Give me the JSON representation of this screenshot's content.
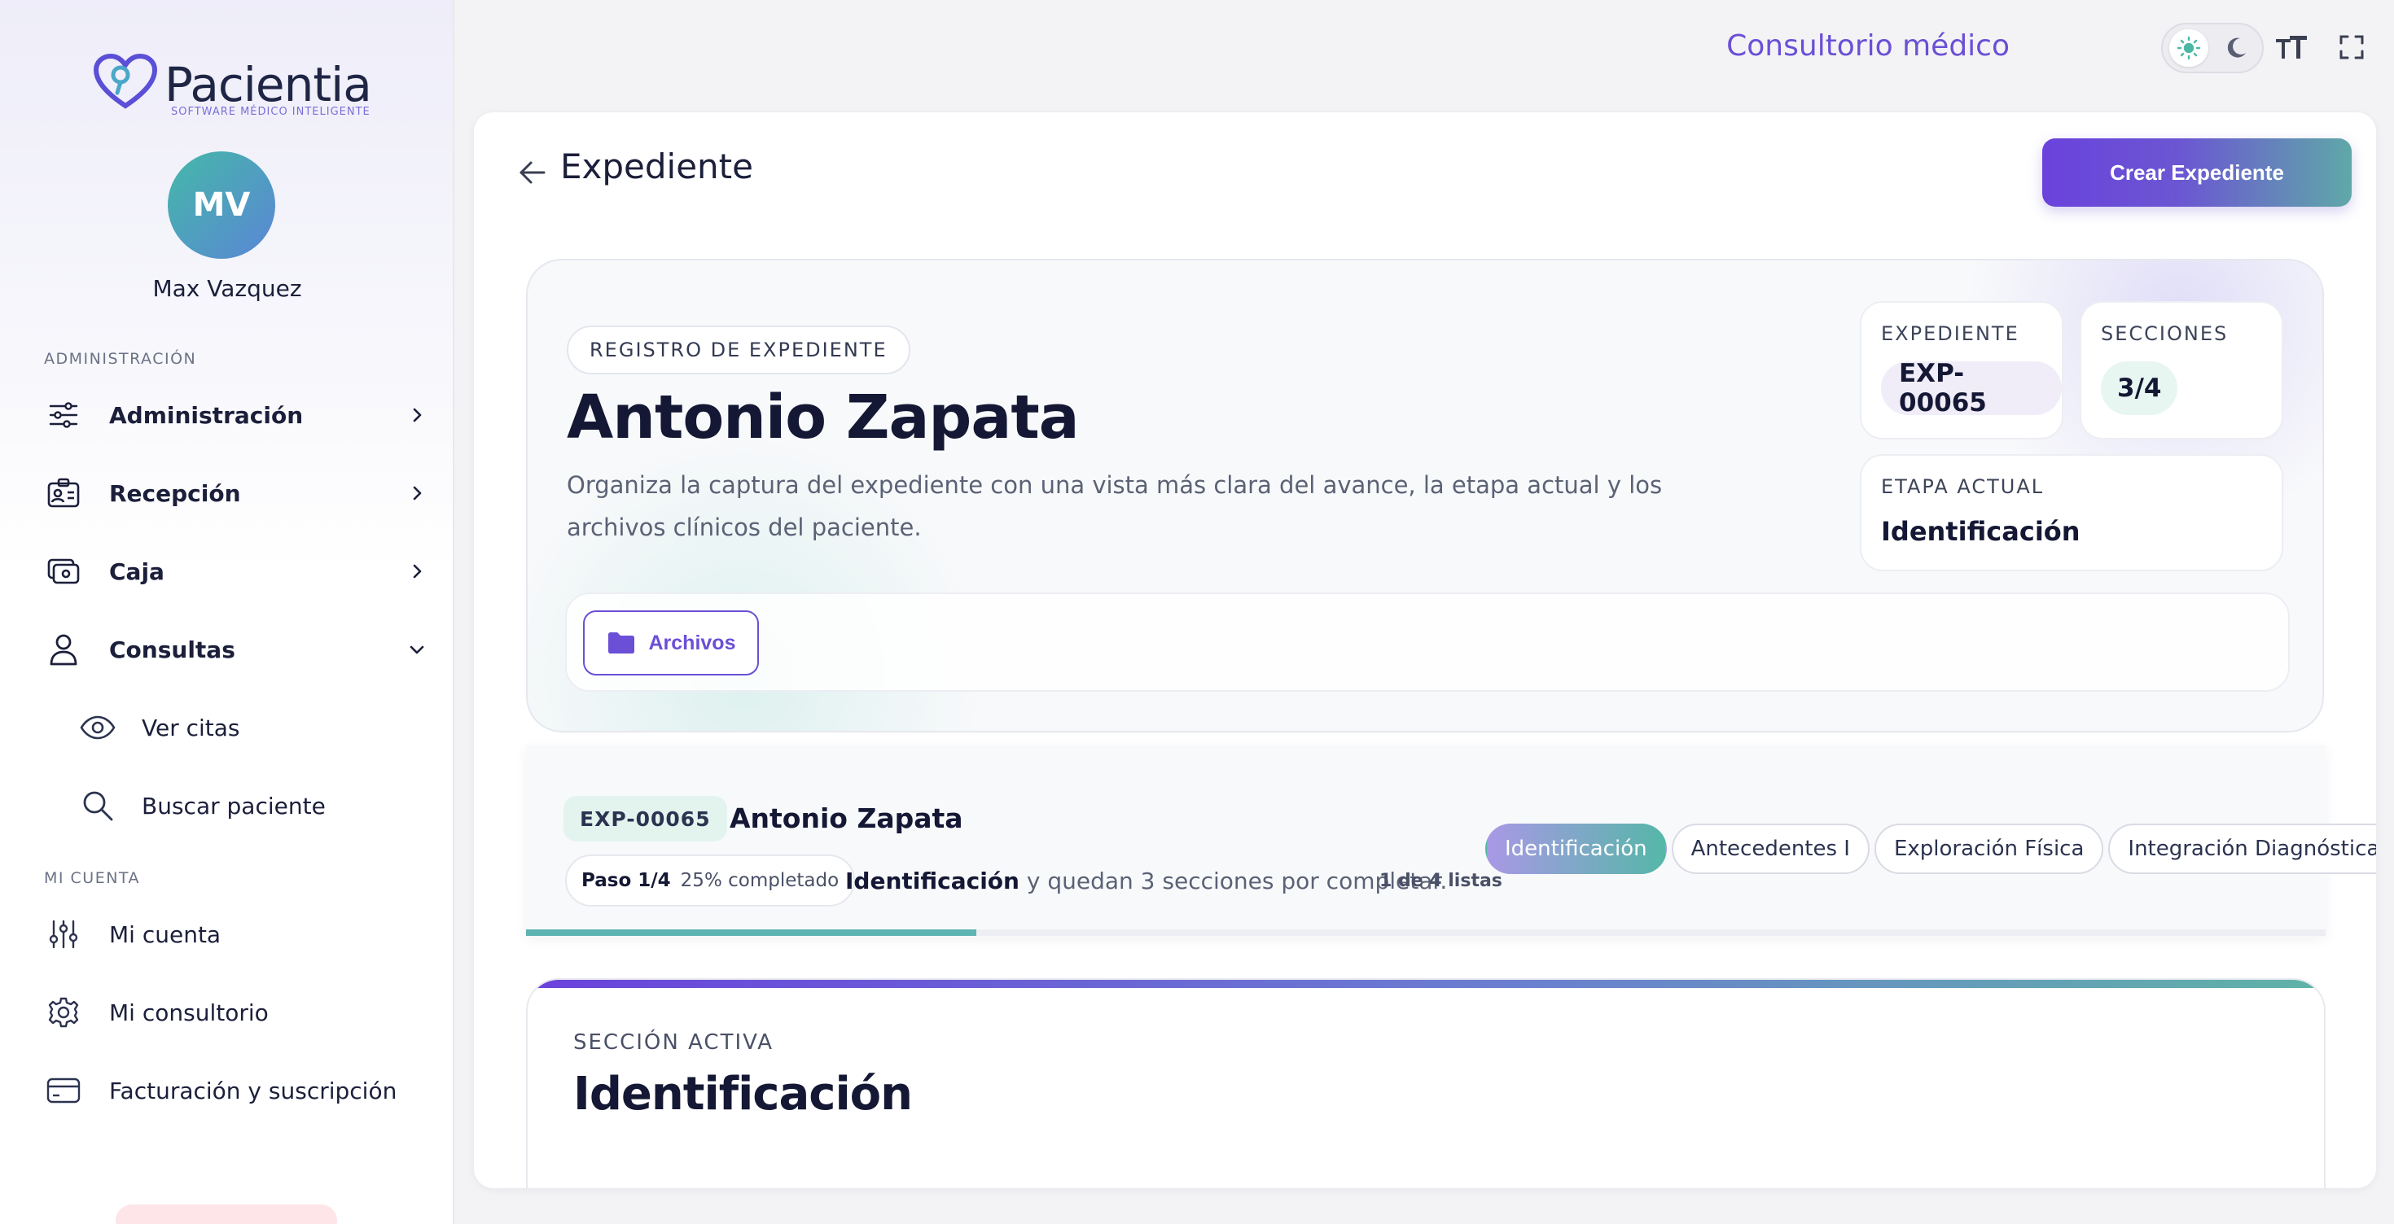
{
  "brand": {
    "name": "Pacientia",
    "tagline": "SOFTWARE MÉDICO INTELIGENTE"
  },
  "user": {
    "initials": "MV",
    "name": "Max Vazquez"
  },
  "sidebar": {
    "admin_section": "ADMINISTRACIÓN",
    "items": [
      {
        "label": "Administración",
        "icon": "sliders-icon",
        "expandable": true
      },
      {
        "label": "Recepción",
        "icon": "id-card-icon",
        "expandable": true
      },
      {
        "label": "Caja",
        "icon": "cash-register-icon",
        "expandable": true
      },
      {
        "label": "Consultas",
        "icon": "user-icon",
        "expandable": true,
        "expanded": true
      }
    ],
    "consultas_sub": [
      {
        "label": "Ver citas",
        "icon": "eye-icon"
      },
      {
        "label": "Buscar paciente",
        "icon": "search-icon"
      }
    ],
    "account_section": "MI CUENTA",
    "account_items": [
      {
        "label": "Mi cuenta",
        "icon": "settings-sliders-icon"
      },
      {
        "label": "Mi consultorio",
        "icon": "gear-icon"
      },
      {
        "label": "Facturación y suscripción",
        "icon": "credit-card-icon"
      }
    ]
  },
  "topbar": {
    "title": "Consultorio médico",
    "theme": "light"
  },
  "page": {
    "title": "Expediente",
    "create_button": "Crear Expediente"
  },
  "hero": {
    "chip": "REGISTRO DE EXPEDIENTE",
    "patient_name": "Antonio Zapata",
    "description": "Organiza la captura del expediente con una vista más clara del avance, la etapa actual y los archivos clínicos del paciente.",
    "stats": {
      "expediente_label": "EXPEDIENTE",
      "expediente_value": "EXP-00065",
      "secciones_label": "SECCIONES",
      "secciones_value": "3/4",
      "etapa_label": "ETAPA ACTUAL",
      "etapa_value": "Identificación"
    },
    "files_button": "Archivos"
  },
  "progress": {
    "exp_id": "EXP-00065",
    "patient_name": "Antonio Zapata",
    "step": "Paso 1/4",
    "completed": "25% completado",
    "current_section": "Identificación",
    "remaining_text": " y quedan 3 secciones por completar.",
    "list_count": "1 de 4 listas",
    "percent": 25,
    "tabs": [
      {
        "label": "Identificación",
        "active": true
      },
      {
        "label": "Antecedentes I",
        "active": false
      },
      {
        "label": "Exploración Física",
        "active": false
      },
      {
        "label": "Integración Diagnóstica",
        "active": false
      }
    ]
  },
  "active_section": {
    "label": "SECCIÓN ACTIVA",
    "title": "Identificación"
  },
  "colors": {
    "accent": "#6b4fd6",
    "teal": "#5eb3b3",
    "text": "#141834"
  }
}
